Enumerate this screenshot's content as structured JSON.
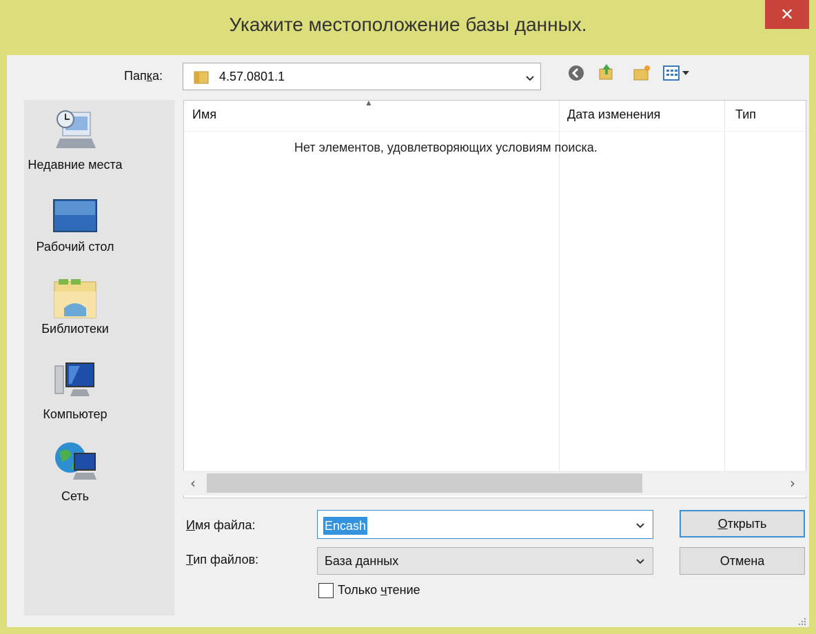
{
  "dialog": {
    "title": "Укажите местоположение базы данных.",
    "close_glyph": "✕"
  },
  "folder_bar": {
    "label_before": "Пап",
    "label_underlined": "к",
    "label_after": "а:",
    "current_folder": "4.57.0801.1",
    "toolbar_icons": [
      "back-icon",
      "up-folder-icon",
      "new-folder-icon",
      "view-menu-icon"
    ]
  },
  "places": [
    {
      "label": "Недавние места",
      "icon": "recent-places-icon"
    },
    {
      "label": "Рабочий стол",
      "icon": "desktop-icon"
    },
    {
      "label": "Библиотеки",
      "icon": "libraries-icon"
    },
    {
      "label": "Компьютер",
      "icon": "computer-icon"
    },
    {
      "label": "Сеть",
      "icon": "network-icon"
    }
  ],
  "file_list": {
    "columns": [
      "Имя",
      "Дата изменения",
      "Тип"
    ],
    "sort_indicator": "▲",
    "empty_message": "Нет элементов, удовлетворяющих условиям поиска."
  },
  "form": {
    "filename_label_underlined": "И",
    "filename_label_rest": "мя файла:",
    "filename_value": "Encash",
    "filetype_label_underlined": "Т",
    "filetype_label_rest": "ип файлов:",
    "filetype_value": "База данных",
    "readonly_before": "Только ",
    "readonly_underlined": "ч",
    "readonly_after": "тение",
    "readonly_checked": false
  },
  "buttons": {
    "open_underlined": "О",
    "open_rest": "ткрыть",
    "cancel": "Отмена"
  },
  "colors": {
    "frame": "#dcdd7b",
    "close": "#c8443a",
    "selection": "#3393df",
    "default_button_border": "#3c8fd6"
  }
}
